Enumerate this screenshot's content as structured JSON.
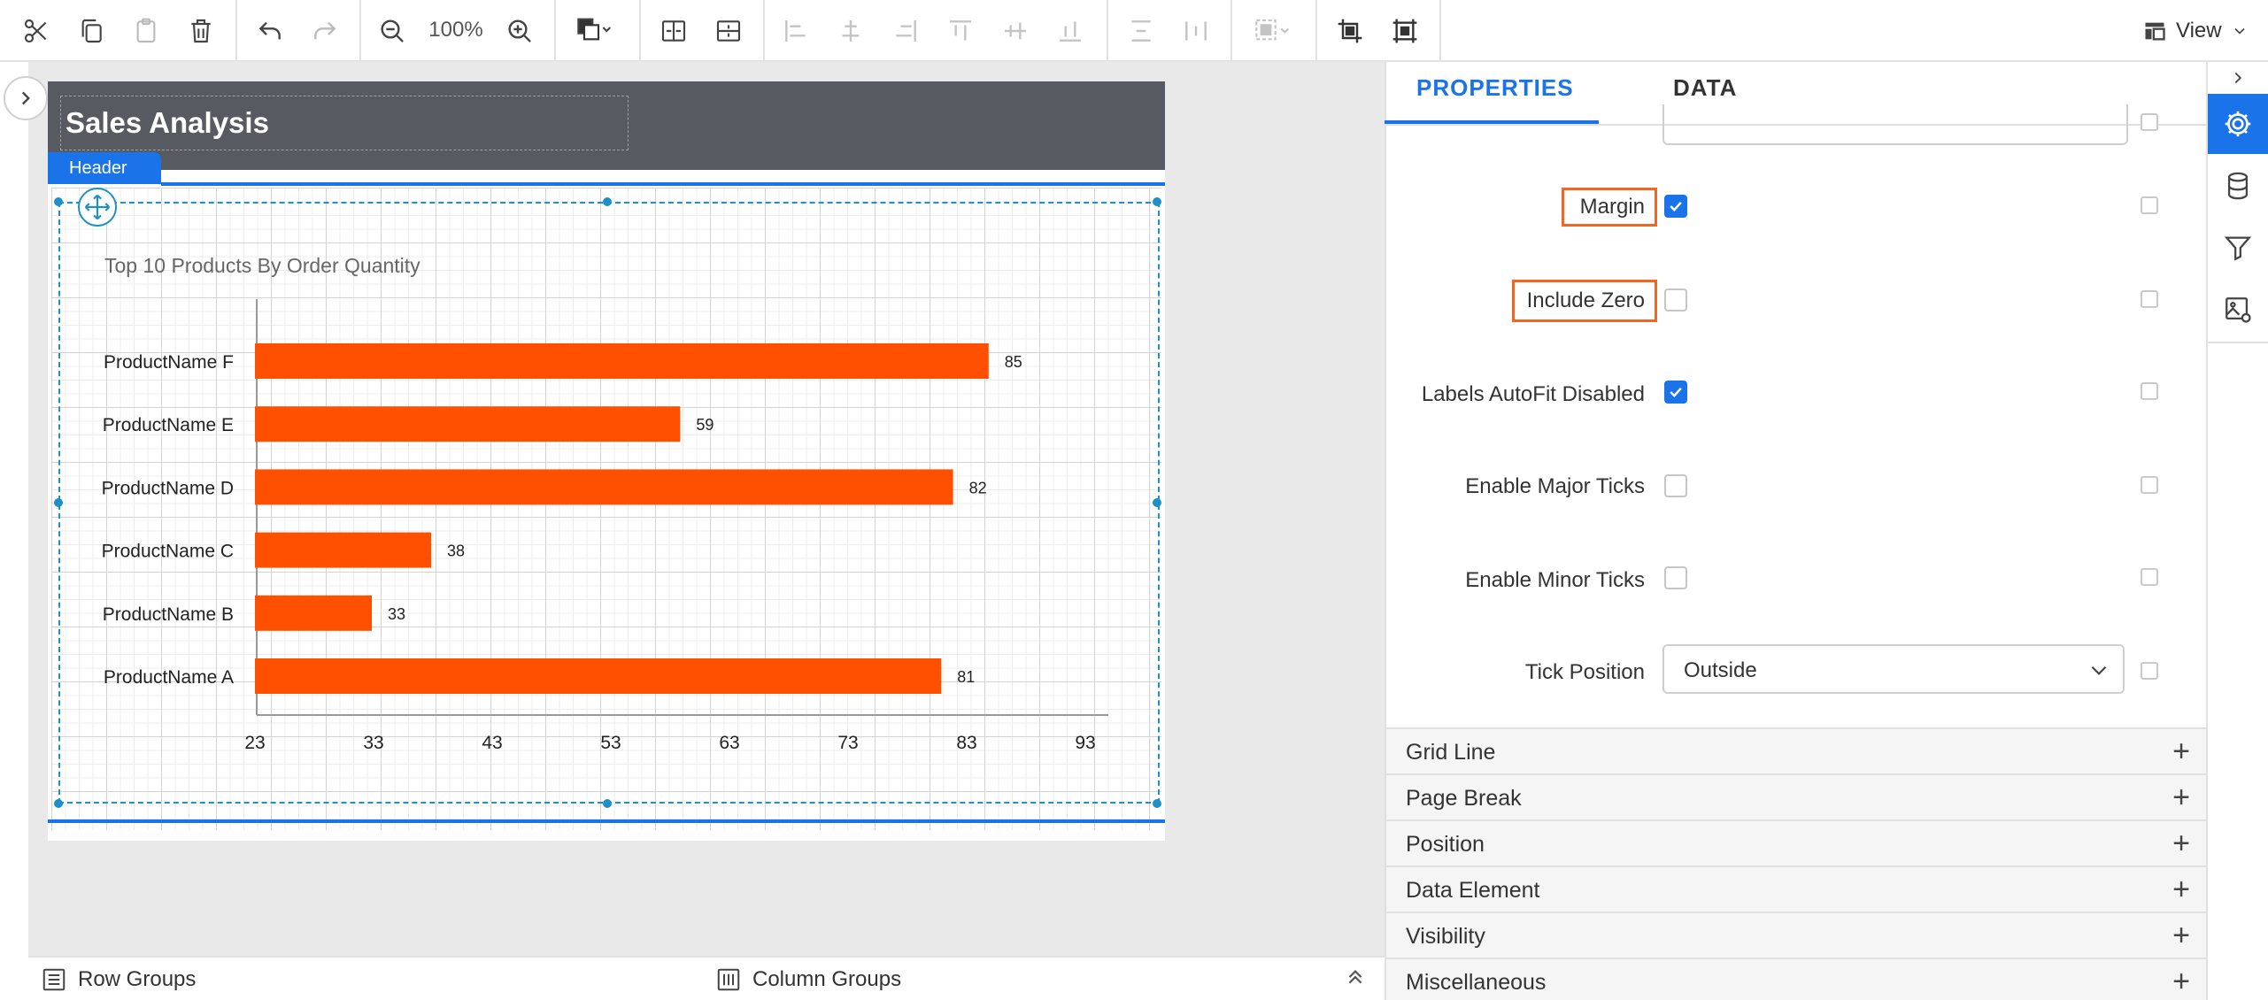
{
  "toolbar": {
    "zoom": "100%",
    "view_label": "View"
  },
  "report": {
    "title": "Sales Analysis",
    "header_tab": "Header"
  },
  "chart_data": {
    "type": "bar",
    "title": "Top 10 Products By Order Quantity",
    "categories": [
      "ProductName F",
      "ProductName E",
      "ProductName D",
      "ProductName C",
      "ProductName B",
      "ProductName A"
    ],
    "values": [
      85,
      59,
      82,
      38,
      33,
      81
    ],
    "x_ticks": [
      "23",
      "33",
      "43",
      "53",
      "63",
      "73",
      "83",
      "93"
    ],
    "xlim": [
      23,
      93
    ],
    "bar_color": "#fe5000",
    "orientation": "horizontal"
  },
  "bottom": {
    "row_groups": "Row Groups",
    "column_groups": "Column Groups"
  },
  "panel": {
    "tabs": [
      "PROPERTIES",
      "DATA"
    ],
    "properties": [
      {
        "label": "Margin",
        "checked": true
      },
      {
        "label": "Include Zero",
        "checked": false
      },
      {
        "label": "Labels AutoFit Disabled",
        "checked": true
      },
      {
        "label": "Enable Major Ticks",
        "checked": false
      },
      {
        "label": "Enable Minor Ticks",
        "checked": false
      }
    ],
    "tick_position_label": "Tick Position",
    "tick_position_value": "Outside",
    "sections": [
      "Grid Line",
      "Page Break",
      "Position",
      "Data Element",
      "Visibility",
      "Miscellaneous"
    ]
  },
  "colors": {
    "accent": "#1a73e8",
    "highlight": "#f26522",
    "header_bg": "#575b61"
  }
}
